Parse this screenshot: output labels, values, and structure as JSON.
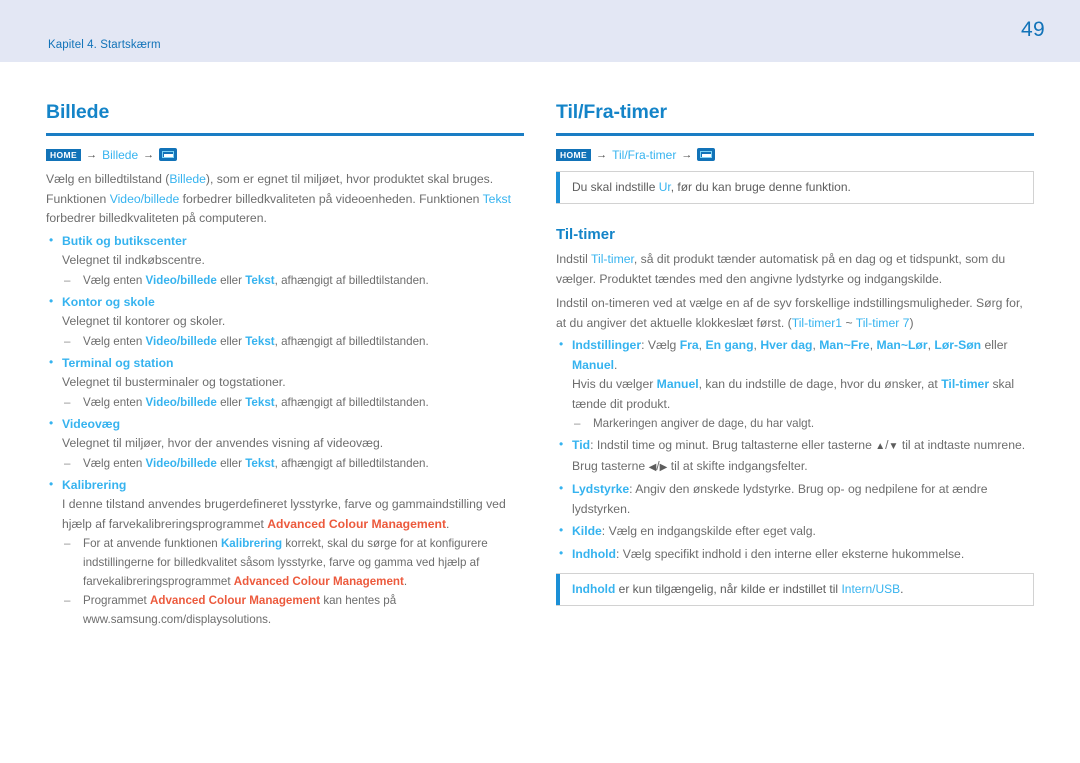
{
  "header": {
    "chapter": "Kapitel 4. Startskærm",
    "page_number": "49",
    "band_color": "#e3e7f4",
    "accent_color": "#1273b8"
  },
  "colors": {
    "heading_blue": "#1484c8",
    "rule_blue": "#1a7dc4",
    "highlight_blue": "#36b3ef",
    "highlight_red": "#ec5a3d",
    "body_gray": "#6d6d6d"
  },
  "left_column": {
    "title": "Billede",
    "breadcrumb": {
      "home_label": "HOME",
      "arrow": "→",
      "path_label": "Billede",
      "enter_icon": "enter-key-icon"
    },
    "intro_line1_a": "Vælg en billedtilstand (",
    "intro_line1_hl": "Billede",
    "intro_line1_b": "), som er egnet til miljøet, hvor produktet skal bruges.",
    "intro_line2_a": "Funktionen ",
    "intro_line2_hl1": "Video/billede",
    "intro_line2_b": " forbedrer billedkvaliteten på videoenheden. Funktionen ",
    "intro_line2_hl2": "Tekst",
    "intro_line3": "forbedrer billedkvaliteten på computeren.",
    "sub_note_prefix": "Vælg enten ",
    "sub_note_hl1": "Video/billede",
    "sub_note_mid": " eller ",
    "sub_note_hl2": "Tekst",
    "sub_note_suffix": ", afhængigt af billedtilstanden.",
    "items": [
      {
        "title": "Butik og butikscenter",
        "desc": "Velegnet til indkøbscentre.",
        "has_mode_note": true
      },
      {
        "title": "Kontor og skole",
        "desc": "Velegnet til kontorer og skoler.",
        "has_mode_note": true
      },
      {
        "title": "Terminal og station",
        "desc": "Velegnet til busterminaler og togstationer.",
        "has_mode_note": true
      },
      {
        "title": "Videovæg",
        "desc": "Velegnet til miljøer, hvor der anvendes visning af videovæg.",
        "has_mode_note": true
      }
    ],
    "calibration": {
      "title": "Kalibrering",
      "desc_a": "I denne tilstand anvendes brugerdefineret lysstyrke, farve og gammaindstilling ved hjælp af farvekalibreringsprogrammet ",
      "desc_red": "Advanced Colour Management",
      "desc_b": ".",
      "note1_a": "For at anvende funktionen ",
      "note1_hl": "Kalibrering",
      "note1_b": " korrekt, skal du sørge for at konfigurere indstillingerne for billedkvalitet såsom lysstyrke, farve og gamma ved hjælp af farvekalibreringsprogrammet ",
      "note1_red": "Advanced Colour Management",
      "note1_c": ".",
      "note2_a": "Programmet ",
      "note2_red": "Advanced Colour Management",
      "note2_b": " kan hentes på www.samsung.com/displaysolutions."
    }
  },
  "right_column": {
    "title": "Til/Fra-timer",
    "breadcrumb": {
      "home_label": "HOME",
      "arrow": "→",
      "path_label": "Til/Fra-timer",
      "enter_icon": "enter-key-icon"
    },
    "notice_top": {
      "text_a": "Du skal indstille ",
      "text_hl": "Ur",
      "text_b": ", før du kan bruge denne funktion."
    },
    "sub_title": "Til-timer",
    "para1_a": "Indstil ",
    "para1_hl": "Til-timer",
    "para1_b": ", så dit produkt tænder automatisk på en dag og et tidspunkt, som du vælger. Produktet tændes med den angivne lydstyrke og indgangskilde.",
    "para2_a": "Indstil on-timeren ved at vælge en af de syv forskellige indstillingsmuligheder. Sørg for, at du angiver det aktuelle klokkeslæt først. (",
    "para2_hl1": "Til-timer1",
    "para2_tilde": " ~ ",
    "para2_hl2": "Til-timer 7",
    "para2_b": ")",
    "items": [
      {
        "name": "Indstillinger",
        "sep": ": Vælg ",
        "options": [
          "Fra",
          "En gang",
          "Hver dag",
          "Man~Fre",
          "Man~Lør",
          "Lør-Søn"
        ],
        "options_sep": ", ",
        "last_join": " eller ",
        "last_option": "Manuel",
        "tail": ".",
        "extra_a": "Hvis du vælger ",
        "extra_hl1": "Manuel",
        "extra_b": ", kan du indstille de dage, hvor du ønsker, at ",
        "extra_hl2": "Til-timer",
        "extra_c": " skal tænde dit produkt.",
        "sub_note": "Markeringen angiver de dage, du har valgt."
      },
      {
        "name": "Tid",
        "desc_a": ": Indstil time og minut. Brug taltasterne eller tasterne ",
        "key_up": "▲",
        "key_slash": "/",
        "key_down": "▼",
        "desc_b": " til at indtaste numrene. Brug tasterne ",
        "key_left": "◀",
        "key_right": "▶",
        "desc_c": " til at skifte indgangsfelter."
      },
      {
        "name": "Lydstyrke",
        "desc": ": Angiv den ønskede lydstyrke. Brug op- og nedpilene for at ændre lydstyrken."
      },
      {
        "name": "Kilde",
        "desc": ": Vælg en indgangskilde efter eget valg."
      },
      {
        "name": "Indhold",
        "desc": ": Vælg specifikt indhold i den interne eller eksterne hukommelse."
      }
    ],
    "notice_bottom": {
      "text_hl1": "Indhold",
      "text_a": " er kun tilgængelig, når kilde er indstillet til ",
      "text_hl2": "Intern/USB",
      "text_b": "."
    }
  }
}
